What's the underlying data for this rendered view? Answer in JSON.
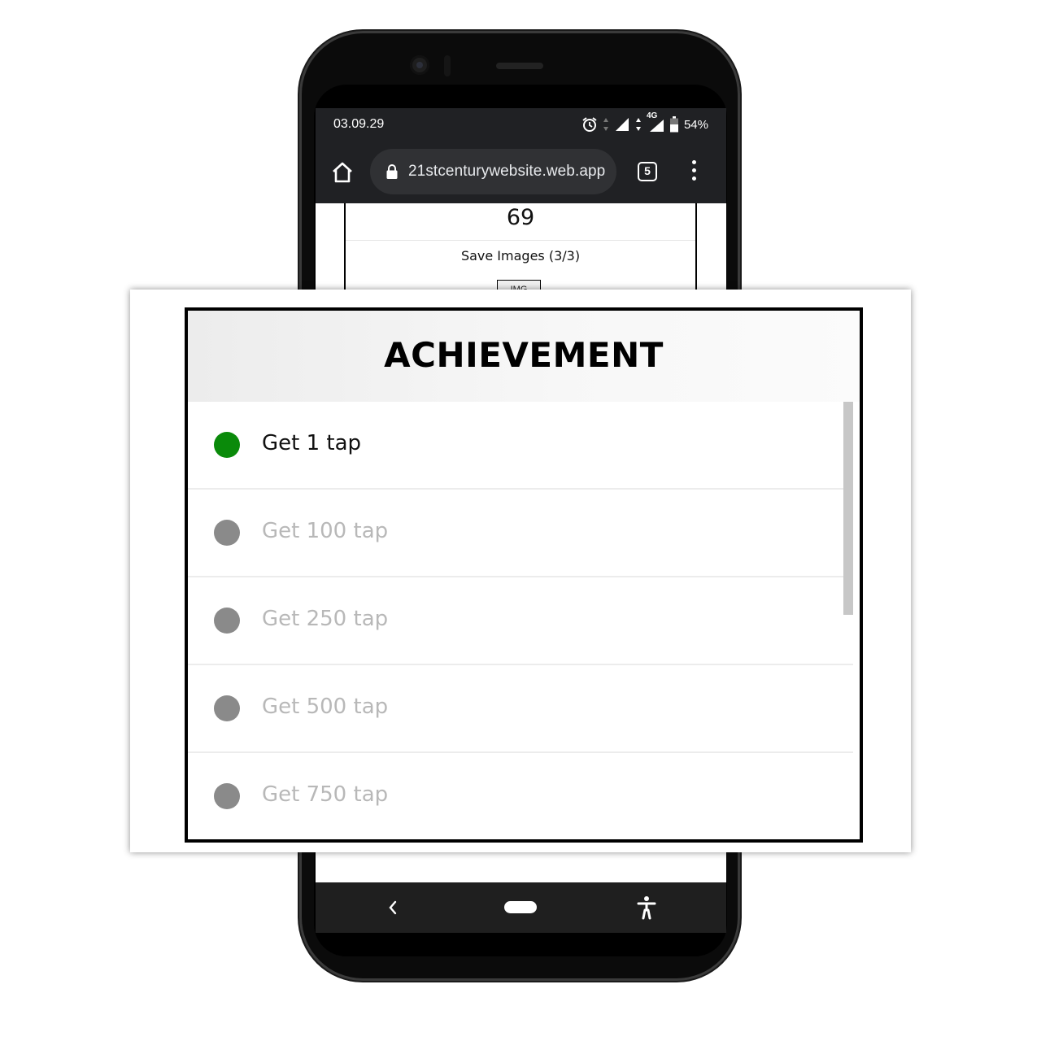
{
  "status_bar": {
    "time": "03.09.29",
    "network": "4G",
    "battery": "54%",
    "icons": [
      "alarm-icon",
      "data-arrows-icon",
      "signal-icon",
      "signal-4g-icon",
      "battery-icon"
    ]
  },
  "browser": {
    "url": "21stcenturywebsite.web.app",
    "tab_count": "5",
    "icons": [
      "home-icon",
      "lock-icon",
      "tab-switcher-icon",
      "more-vert-icon"
    ]
  },
  "page": {
    "score": "69",
    "save_images": "Save Images (3/3)",
    "img_button": "IMG"
  },
  "achievement": {
    "title": "ACHIEVEMENT",
    "items": [
      {
        "label": "Get 1 tap",
        "unlocked": true
      },
      {
        "label": "Get 100 tap",
        "unlocked": false
      },
      {
        "label": "Get 250 tap",
        "unlocked": false
      },
      {
        "label": "Get 500 tap",
        "unlocked": false
      },
      {
        "label": "Get 750 tap",
        "unlocked": false
      }
    ]
  },
  "nav_bar": {
    "icons": [
      "back-icon",
      "home-pill-icon",
      "accessibility-icon"
    ]
  },
  "colors": {
    "unlocked_dot": "#0a8a0a",
    "locked_dot": "#8a8a8a",
    "unlocked_text": "#111111",
    "locked_text": "#b8b8b8",
    "browser_bar": "#202124",
    "url_pill": "#303134"
  }
}
